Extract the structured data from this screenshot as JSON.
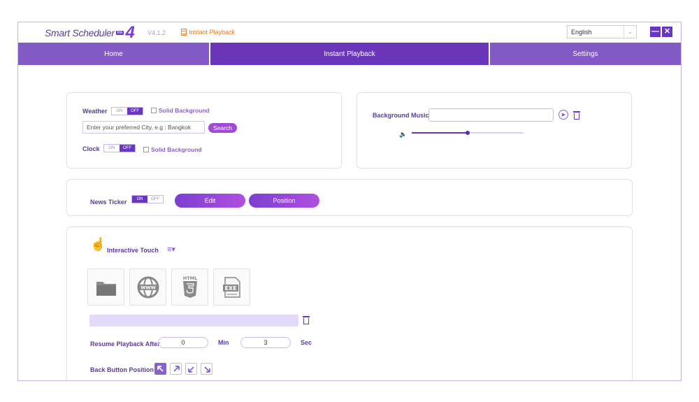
{
  "app": {
    "logo_text": "Smart Scheduler",
    "logo_badge": "lite",
    "logo_version_mark": "4",
    "version": "V4.1.2",
    "instant_link": "Instant Playback",
    "language": "English"
  },
  "window_controls": {
    "minimize": "—",
    "close": "✕"
  },
  "nav": {
    "home": "Home",
    "instant": "Instant Playback",
    "settings": "Settings"
  },
  "weather": {
    "label": "Weather",
    "toggle_on": "ON",
    "toggle_off": "OFF",
    "toggle_state": "OFF",
    "solid_bg": "Solid Background",
    "solid_bg_checked": false,
    "city_placeholder": "Enter your preferred City, e.g : Bangkok",
    "search_button": "Search"
  },
  "clock": {
    "label": "Clock",
    "toggle_on": "ON",
    "toggle_off": "OFF",
    "toggle_state": "OFF",
    "solid_bg": "Solid Background",
    "solid_bg_checked": false
  },
  "music": {
    "label": "Background Music",
    "value": "",
    "volume_fraction": 0.5
  },
  "news": {
    "label": "News Ticker",
    "toggle_on": "ON",
    "toggle_off": "OFF",
    "toggle_state": "ON",
    "edit_button": "Edit",
    "position_button": "Position"
  },
  "touch": {
    "label": "Interactive Touch",
    "tiles": [
      "folder-icon",
      "www-icon",
      "html5-icon",
      "exe-icon"
    ],
    "resume_label": "Resume Playback After",
    "minutes": "0",
    "min_unit": "Min",
    "seconds": "3",
    "sec_unit": "Sec",
    "back_button_label": "Back Button Position",
    "back_positions": [
      "top-left",
      "top-right",
      "bottom-left",
      "bottom-right"
    ],
    "back_selected": "top-left"
  },
  "colors": {
    "accent": "#6a35c0",
    "nav": "#8259c5",
    "nav_active": "#6a35b8",
    "link": "#e07a2e"
  }
}
